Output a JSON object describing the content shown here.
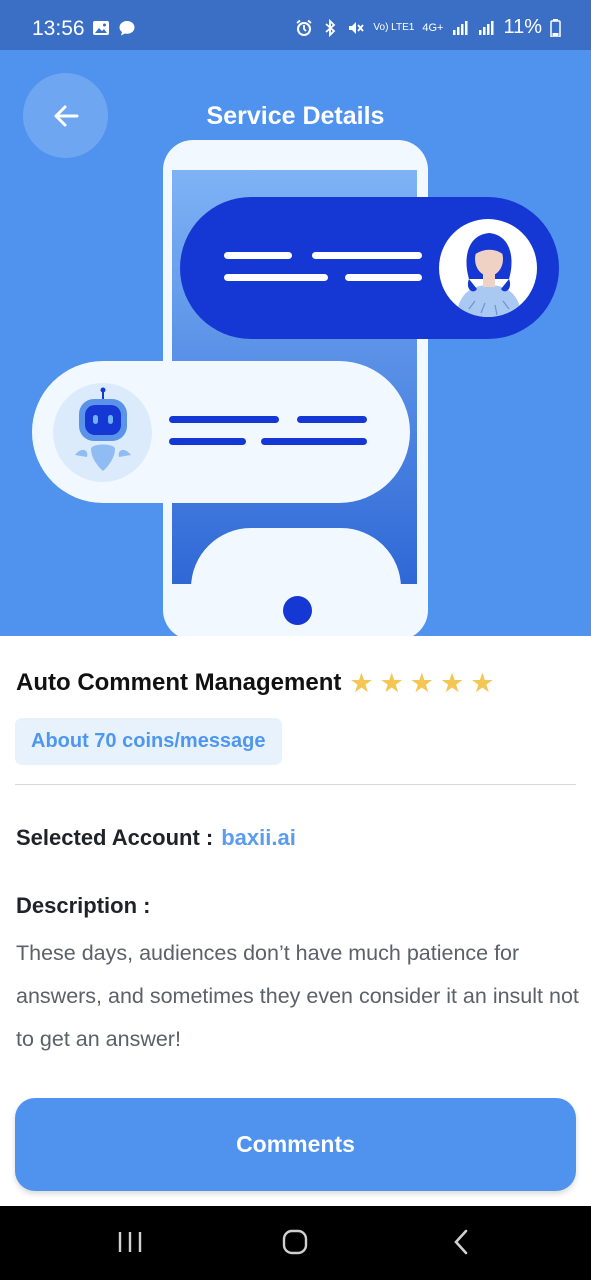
{
  "status_bar": {
    "time": "13:56",
    "battery": "11%",
    "network": "4G+",
    "volte": "Vo) LTE1"
  },
  "header": {
    "title": "Service Details"
  },
  "service": {
    "name": "Auto Comment Management",
    "rating": 5,
    "price": "About 70 coins/message"
  },
  "account": {
    "label": "Selected Account :",
    "value": "baxii.ai"
  },
  "description": {
    "label": "Description :",
    "text": "These days, audiences don’t have much patience for answers, and sometimes they even consider it an insult not to get an answer!"
  },
  "actions": {
    "comments_label": "Comments"
  },
  "colors": {
    "accent": "#4f93ef",
    "dark_blue": "#1537d4",
    "star": "#f4c653",
    "status_bar": "#3b6fc6"
  },
  "icons": {
    "back": "arrow-left-icon",
    "star": "star-icon",
    "nav_recent": "recent-apps-icon",
    "nav_home": "home-icon",
    "nav_back": "chevron-left-icon"
  }
}
